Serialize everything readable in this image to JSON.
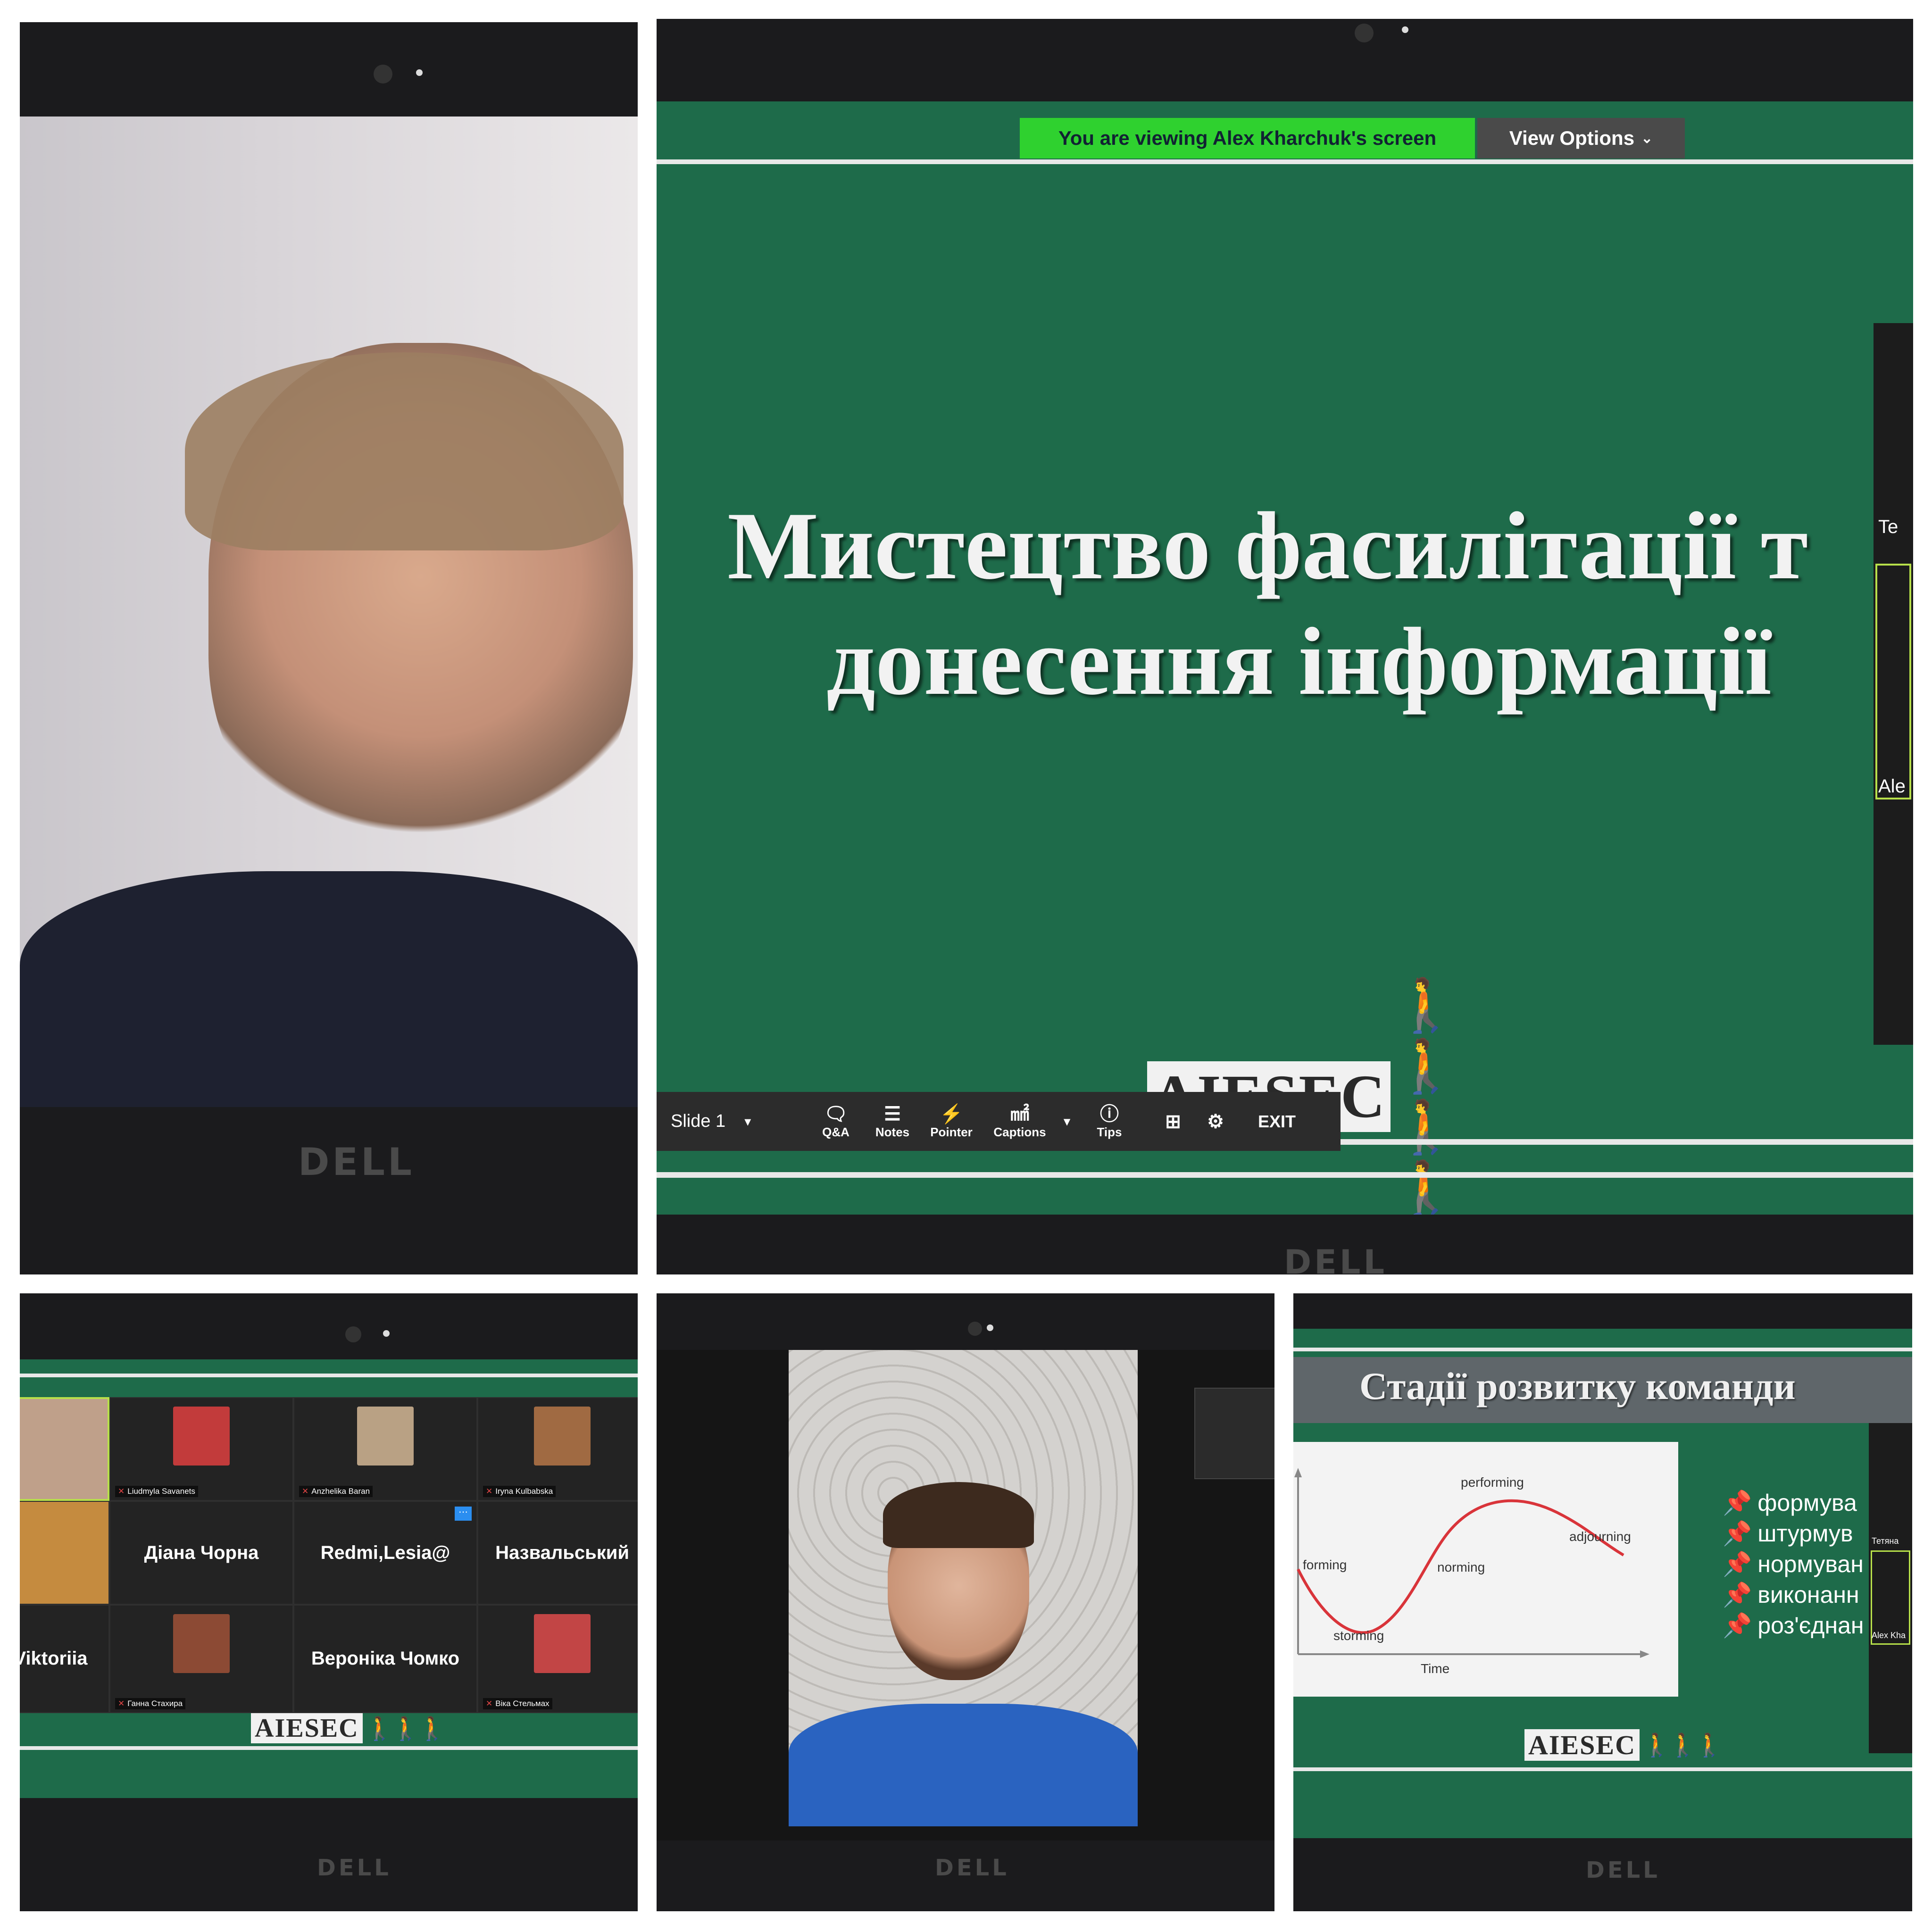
{
  "brand": "DELL",
  "panel_top_left": {
    "description_icon": "user-face"
  },
  "panel_top_right": {
    "banner": "You are viewing Alex Kharchuk's screen",
    "view_options": "View Options",
    "slide_title_line1": "Мистецтво фасилітації т",
    "slide_title_line2": "донесення інформації",
    "toolbar": {
      "slide": "Slide 1",
      "qa": "Q&A",
      "notes": "Notes",
      "pointer": "Pointer",
      "captions": "Captions",
      "tips": "Tips",
      "exit": "EXIT"
    },
    "logo": "AIESEC",
    "side_name_1": "Te",
    "side_name_2": "Ale"
  },
  "panel_bottom_left": {
    "logo": "AIESEC",
    "participants": [
      {
        "name": "Liudmyla Savanets"
      },
      {
        "name": "Anzhelika Baran"
      },
      {
        "name": "Iryna Kulbabska"
      },
      {
        "name": "Діана Чорна"
      },
      {
        "name": "Redmi,Lesia@"
      },
      {
        "name": "Назвальський"
      },
      {
        "name": "Viktoriia"
      },
      {
        "name": "Ганна Стахира"
      },
      {
        "name": "Вероніка Чомко"
      },
      {
        "name": "Віка Стельмах"
      }
    ]
  },
  "panel_bottom_right": {
    "slide_title": "Стадії розвитку команди",
    "chart_labels": {
      "forming": "forming",
      "storming": "storming",
      "norming": "norming",
      "performing": "performing",
      "adjourning": "adjourning",
      "time": "Time"
    },
    "bullets": [
      "формува",
      "штурмув",
      "нормуван",
      "виконанн",
      "роз'єднан"
    ],
    "logo": "AIESEC",
    "side_name_1": "Тетяна",
    "side_name_2": "Alex Kha"
  },
  "colors": {
    "slide_green": "#1e6b4a",
    "banner_green": "#2fd12f",
    "bezel": "#1b1b1d"
  }
}
